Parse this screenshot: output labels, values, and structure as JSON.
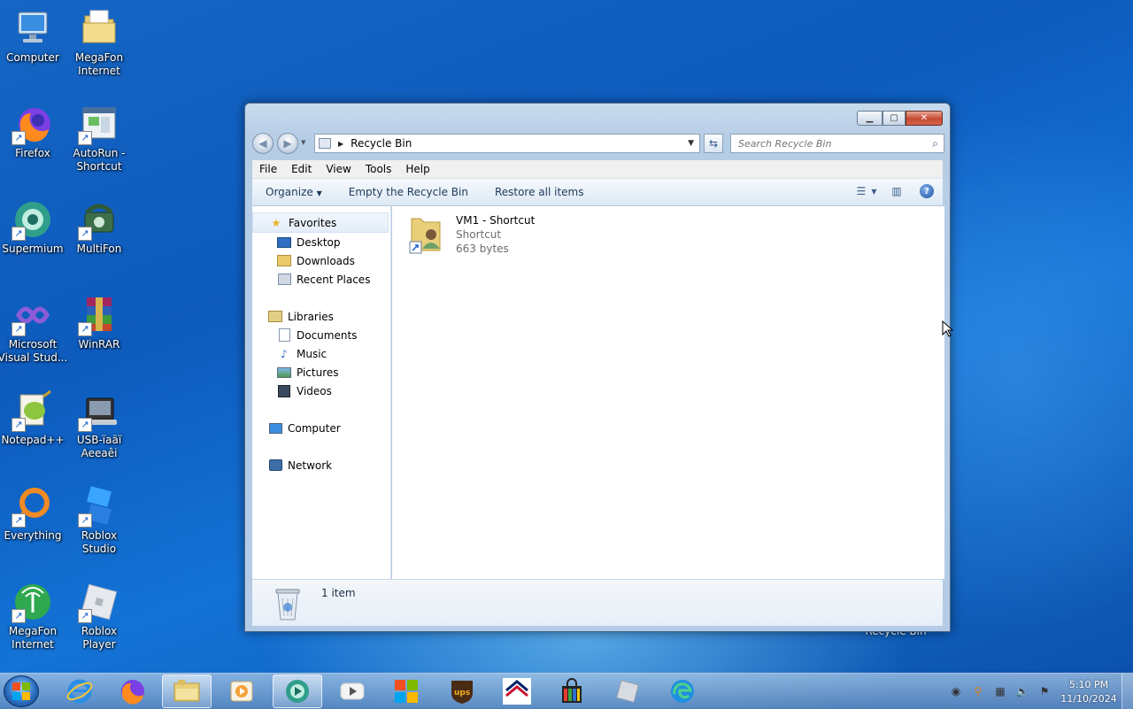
{
  "desktop": {
    "icons": [
      {
        "label": "Computer",
        "icon": "computer-icon"
      },
      {
        "label": "MegaFon Internet",
        "icon": "folder-icon"
      },
      {
        "label": "Firefox",
        "icon": "firefox-icon"
      },
      {
        "label": "AutoRun - Shortcut",
        "icon": "autorun-icon"
      },
      {
        "label": "Supermium",
        "icon": "supermium-icon"
      },
      {
        "label": "MultiFon",
        "icon": "multifon-icon"
      },
      {
        "label": "Microsoft Visual Stud...",
        "icon": "visual-studio-icon"
      },
      {
        "label": "WinRAR",
        "icon": "winrar-icon"
      },
      {
        "label": "Notepad++",
        "icon": "notepadpp-icon"
      },
      {
        "label": "USB-ïaäï Aeeaêi",
        "icon": "usb-modem-icon"
      },
      {
        "label": "Everything",
        "icon": "everything-icon"
      },
      {
        "label": "Roblox Studio",
        "icon": "roblox-studio-icon"
      },
      {
        "label": "MegaFon Internet",
        "icon": "megafon-icon"
      },
      {
        "label": "Roblox Player",
        "icon": "roblox-player-icon"
      }
    ],
    "recycle_bin_label": "Recycle Bin"
  },
  "window": {
    "address": {
      "location": "Recycle Bin"
    },
    "search": {
      "placeholder": "Search Recycle Bin"
    },
    "menu": [
      "File",
      "Edit",
      "View",
      "Tools",
      "Help"
    ],
    "toolbar": {
      "organize": "Organize",
      "empty": "Empty the Recycle Bin",
      "restore": "Restore all items"
    },
    "nav": {
      "favorites": "Favorites",
      "favorites_items": [
        "Desktop",
        "Downloads",
        "Recent Places"
      ],
      "libraries": "Libraries",
      "libraries_items": [
        "Documents",
        "Music",
        "Pictures",
        "Videos"
      ],
      "computer": "Computer",
      "network": "Network"
    },
    "items": [
      {
        "name": "VM1 - Shortcut",
        "type": "Shortcut",
        "size": "663 bytes"
      }
    ],
    "details": {
      "count": "1 item"
    }
  },
  "taskbar": {
    "apps": [
      "Internet Explorer",
      "Firefox",
      "Windows Explorer",
      "Media Player",
      "Supermium",
      "YouTube",
      "Microsoft Store",
      "UPS",
      "Bank of America",
      "Shop",
      "Roblox",
      "Microsoft Edge"
    ],
    "clock": {
      "time": "5:10 PM",
      "date": "11/10/2024"
    }
  },
  "colors": {
    "desktop_blue": "#1565c4",
    "window_frame": "#b6cde6",
    "close_red": "#c74a32"
  }
}
